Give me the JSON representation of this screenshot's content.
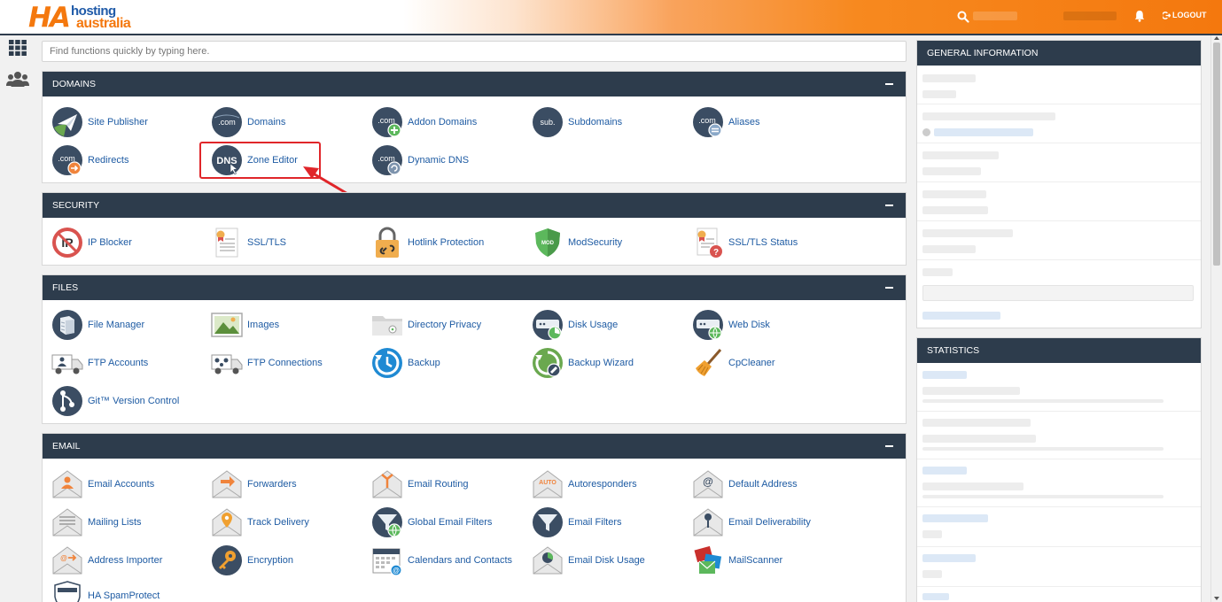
{
  "header": {
    "logo": {
      "ha": "HA",
      "line1": "hosting",
      "line2": "australia"
    },
    "logout_label": "LOGOUT",
    "colors": {
      "accent": "#f4780e",
      "brand_blue": "#1f5aa8",
      "panel_head": "#2d3c4c",
      "link": "#1e5ba3"
    }
  },
  "search": {
    "placeholder": "Find functions quickly by typing here."
  },
  "sections": {
    "domains": {
      "title": "DOMAINS",
      "items": [
        "Site Publisher",
        "Domains",
        "Addon Domains",
        "Subdomains",
        "Aliases",
        "Redirects",
        "Zone Editor",
        "Dynamic DNS"
      ]
    },
    "security": {
      "title": "SECURITY",
      "items": [
        "IP Blocker",
        "SSL/TLS",
        "Hotlink Protection",
        "ModSecurity",
        "SSL/TLS Status"
      ]
    },
    "files": {
      "title": "FILES",
      "items": [
        "File Manager",
        "Images",
        "Directory Privacy",
        "Disk Usage",
        "Web Disk",
        "FTP Accounts",
        "FTP Connections",
        "Backup",
        "Backup Wizard",
        "CpCleaner",
        "Git™ Version Control"
      ]
    },
    "email": {
      "title": "EMAIL",
      "items": [
        "Email Accounts",
        "Forwarders",
        "Email Routing",
        "Autoresponders",
        "Default Address",
        "Mailing Lists",
        "Track Delivery",
        "Global Email Filters",
        "Email Filters",
        "Email Deliverability",
        "Address Importer",
        "Encryption",
        "Calendars and Contacts",
        "Email Disk Usage",
        "MailScanner",
        "HA SpamProtect"
      ]
    }
  },
  "sidebar": {
    "general_title": "GENERAL INFORMATION",
    "statistics_title": "STATISTICS"
  },
  "icon_labels": {
    "com": ".com",
    "sub": "sub.",
    "dns": "DNS",
    "mod": "MOD",
    "auto": "AUTO",
    "at": "@"
  }
}
